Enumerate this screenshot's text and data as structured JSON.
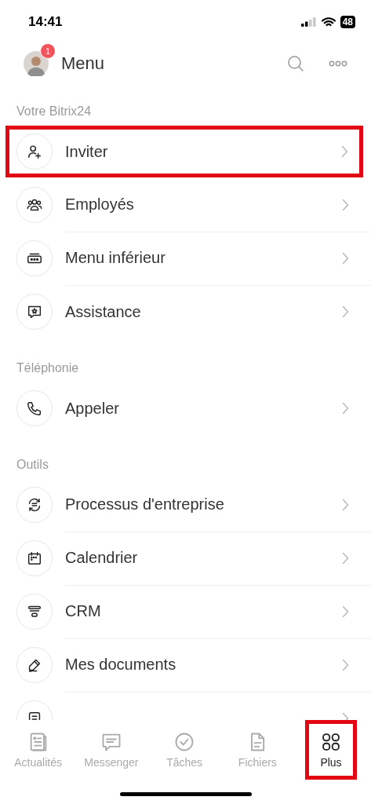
{
  "status_bar": {
    "time": "14:41",
    "battery": "48"
  },
  "header": {
    "title": "Menu",
    "badge": "1"
  },
  "sections": [
    {
      "title": "Votre Bitrix24",
      "items": [
        {
          "label": "Inviter",
          "kind": "invite",
          "highlighted": true
        },
        {
          "label": "Employés",
          "kind": "people",
          "highlighted": false
        },
        {
          "label": "Menu inférieur",
          "kind": "toolbar",
          "highlighted": false
        },
        {
          "label": "Assistance",
          "kind": "support",
          "highlighted": false
        }
      ]
    },
    {
      "title": "Téléphonie",
      "items": [
        {
          "label": "Appeler",
          "kind": "phone",
          "highlighted": false
        }
      ]
    },
    {
      "title": "Outils",
      "items": [
        {
          "label": "Processus d'entreprise",
          "kind": "process",
          "highlighted": false
        },
        {
          "label": "Calendrier",
          "kind": "calendar",
          "highlighted": false
        },
        {
          "label": "CRM",
          "kind": "funnel",
          "highlighted": false
        },
        {
          "label": "Mes documents",
          "kind": "pen",
          "highlighted": false
        },
        {
          "kind": "book",
          "highlighted": false
        }
      ]
    }
  ],
  "tabs": [
    {
      "label": "Actualités",
      "kind": "news",
      "selected": false,
      "highlighted": false
    },
    {
      "label": "Messenger",
      "kind": "chat",
      "selected": false,
      "highlighted": false
    },
    {
      "label": "Tâches",
      "kind": "check",
      "selected": false,
      "highlighted": false
    },
    {
      "label": "Fichiers",
      "kind": "file",
      "selected": false,
      "highlighted": false
    },
    {
      "label": "Plus",
      "kind": "grid",
      "selected": true,
      "highlighted": true
    }
  ]
}
